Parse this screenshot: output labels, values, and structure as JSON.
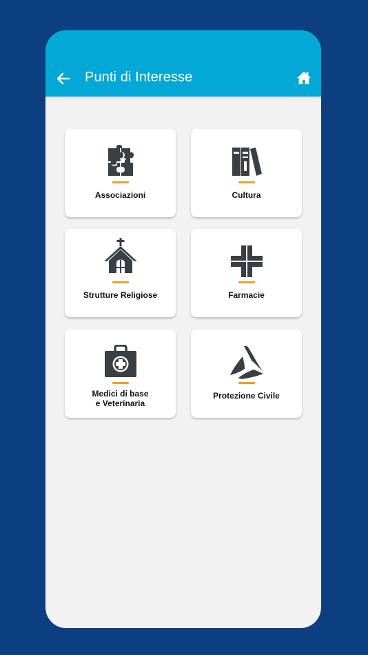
{
  "header": {
    "title": "Punti di Interesse",
    "back_icon": "arrow-left-icon",
    "home_icon": "home-icon"
  },
  "colors": {
    "background": "#0b3f80",
    "appbar": "#04a8d6",
    "accent_underline": "#f0a020",
    "icon_dark": "#3a3f44"
  },
  "categories": [
    {
      "label": "Associazioni",
      "icon": "puzzle-icon"
    },
    {
      "label": "Cultura",
      "icon": "books-icon"
    },
    {
      "label": "Strutture Religiose",
      "icon": "church-icon"
    },
    {
      "label": "Farmacie",
      "icon": "pharmacy-cross-icon"
    },
    {
      "label": "Medici di base\ne Veterinaria",
      "icon": "medical-kit-icon"
    },
    {
      "label": "Protezione Civile",
      "icon": "civil-protection-icon"
    }
  ]
}
